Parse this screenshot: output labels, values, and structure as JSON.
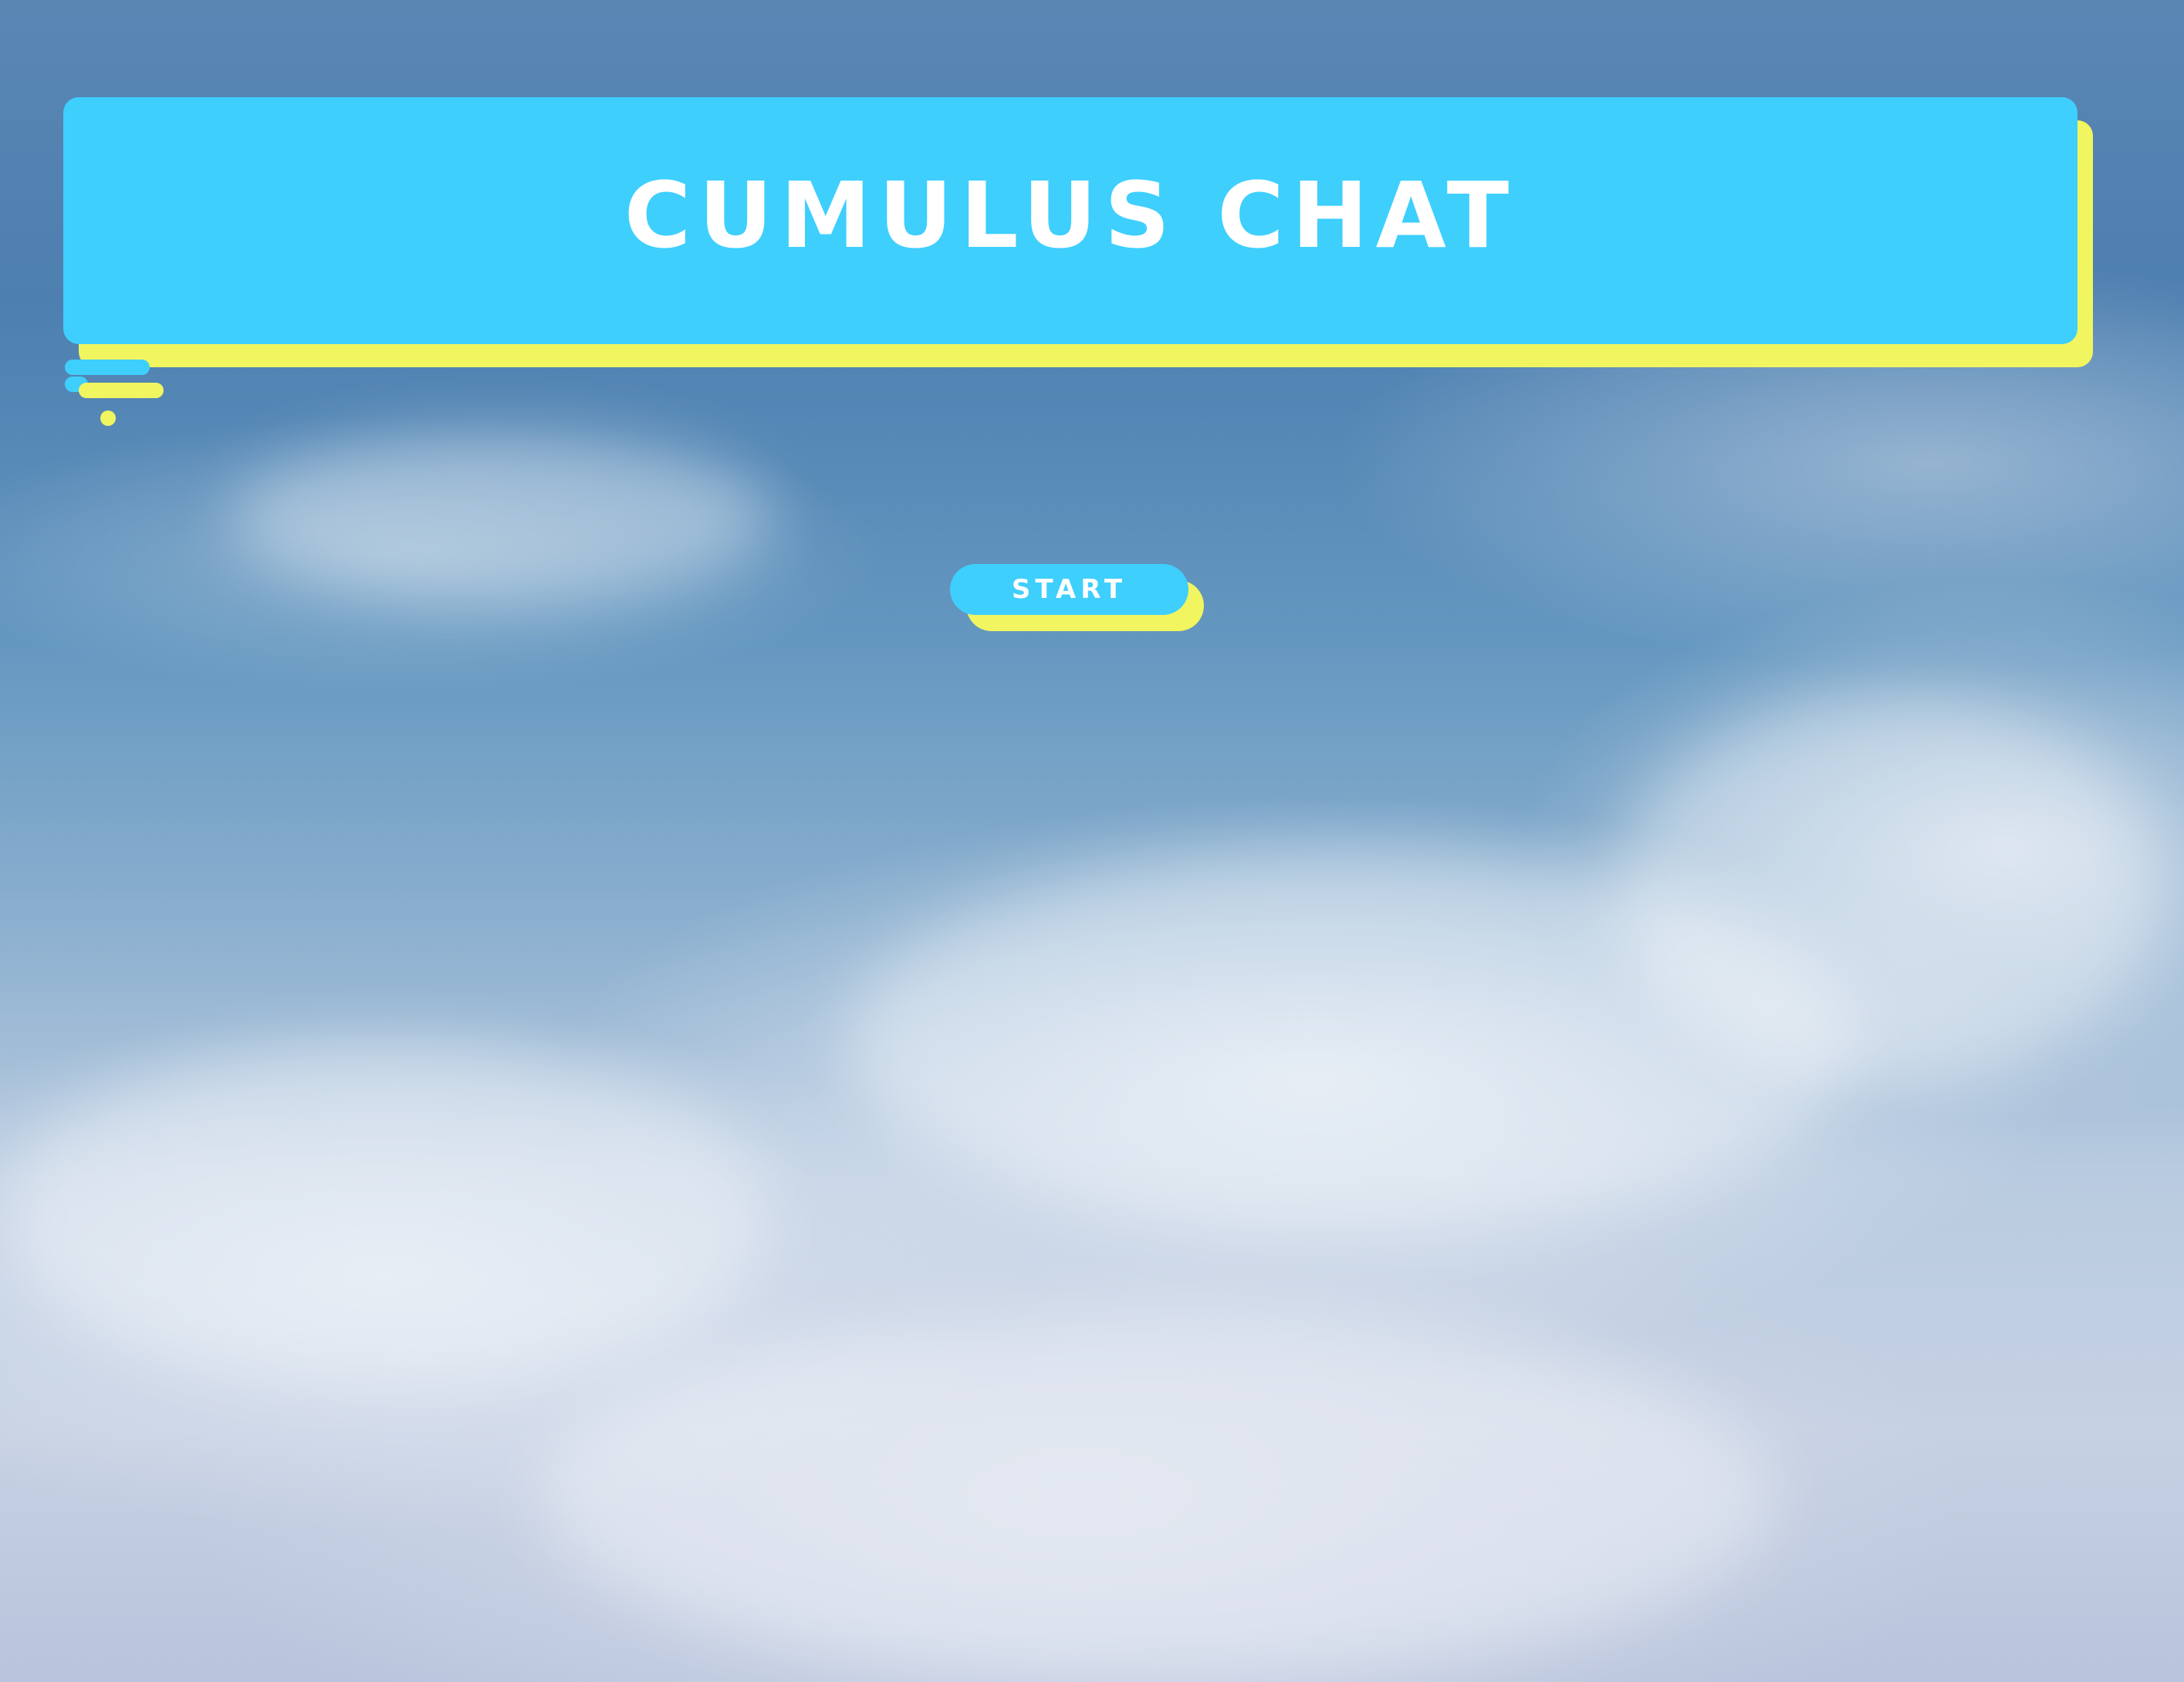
{
  "app": {
    "title": "CUMULUS CHAT"
  },
  "start": {
    "label": "START"
  },
  "colors": {
    "banner": "#3ecffd",
    "accent_shadow": "#f1f560",
    "text": "#ffffff",
    "sky_top": "#4d7fb0",
    "sky_bottom": "#c6d1e3"
  },
  "background": {
    "icon": "cloudy-sky-background"
  }
}
